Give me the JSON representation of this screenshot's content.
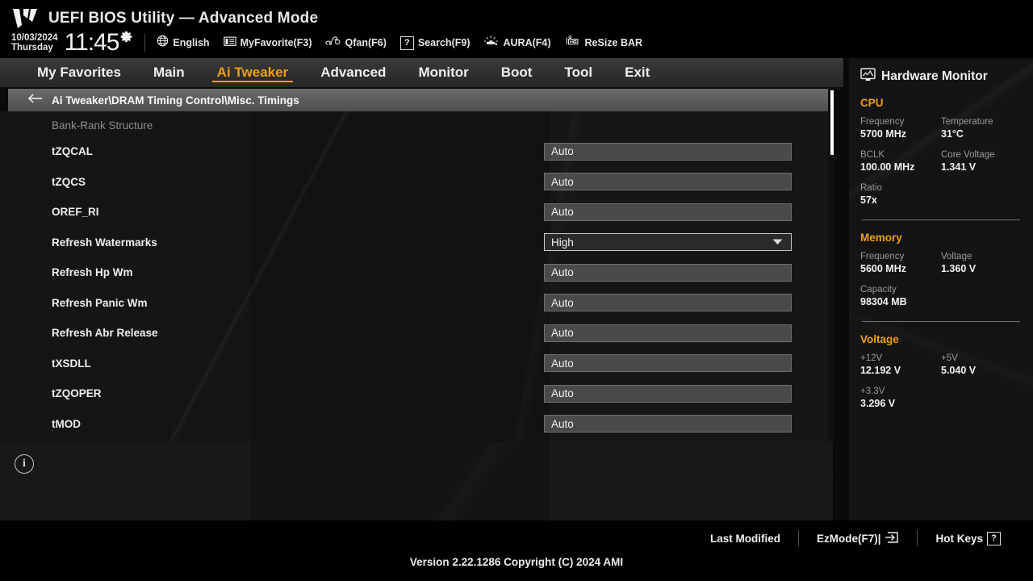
{
  "header": {
    "logo_icon": "tuf-gaming-logo",
    "title": "UEFI BIOS Utility — Advanced Mode",
    "date": "10/03/2024",
    "day": "Thursday",
    "time": "11:45",
    "gear_icon": "gear-icon",
    "items": [
      {
        "icon": "globe-icon",
        "label": "English"
      },
      {
        "icon": "favorites-icon",
        "label": "MyFavorite(F3)"
      },
      {
        "icon": "fan-icon",
        "label": "Qfan(F6)"
      },
      {
        "icon": "question-box-icon",
        "label": "Search(F9)"
      },
      {
        "icon": "aura-light-icon",
        "label": "AURA(F4)"
      },
      {
        "icon": "resize-bar-icon",
        "label": "ReSize BAR"
      }
    ]
  },
  "nav": {
    "tabs": [
      {
        "label": "My Favorites",
        "active": false
      },
      {
        "label": "Main",
        "active": false
      },
      {
        "label": "Ai Tweaker",
        "active": true
      },
      {
        "label": "Advanced",
        "active": false
      },
      {
        "label": "Monitor",
        "active": false
      },
      {
        "label": "Boot",
        "active": false
      },
      {
        "label": "Tool",
        "active": false
      },
      {
        "label": "Exit",
        "active": false
      }
    ]
  },
  "breadcrumb": {
    "back_icon": "back-arrow-icon",
    "path": "Ai Tweaker\\DRAM Timing Control\\Misc. Timings"
  },
  "main": {
    "group_header": "Bank-Rank Structure",
    "settings": [
      {
        "label": "tZQCAL",
        "value": "Auto",
        "focused": false
      },
      {
        "label": "tZQCS",
        "value": "Auto",
        "focused": false
      },
      {
        "label": "OREF_RI",
        "value": "Auto",
        "focused": false
      },
      {
        "label": "Refresh Watermarks",
        "value": "High",
        "focused": true
      },
      {
        "label": "Refresh Hp Wm",
        "value": "Auto",
        "focused": false
      },
      {
        "label": "Refresh Panic Wm",
        "value": "Auto",
        "focused": false
      },
      {
        "label": "Refresh Abr Release",
        "value": "Auto",
        "focused": false
      },
      {
        "label": "tXSDLL",
        "value": "Auto",
        "focused": false
      },
      {
        "label": "tZQOPER",
        "value": "Auto",
        "focused": false
      },
      {
        "label": "tMOD",
        "value": "Auto",
        "focused": false
      }
    ],
    "help_info_icon": "info-circle-icon"
  },
  "hardware_monitor": {
    "icon": "monitor-icon",
    "title": "Hardware Monitor",
    "sections": [
      {
        "title": "CPU",
        "entries": [
          {
            "key": "Frequency",
            "value": "5700 MHz",
            "full": false
          },
          {
            "key": "Temperature",
            "value": "31°C",
            "full": false
          },
          {
            "key": "BCLK",
            "value": "100.00 MHz",
            "full": false
          },
          {
            "key": "Core Voltage",
            "value": "1.341 V",
            "full": false
          },
          {
            "key": "Ratio",
            "value": "57x",
            "full": true
          }
        ]
      },
      {
        "title": "Memory",
        "entries": [
          {
            "key": "Frequency",
            "value": "5600 MHz",
            "full": false
          },
          {
            "key": "Voltage",
            "value": "1.360 V",
            "full": false
          },
          {
            "key": "Capacity",
            "value": "98304 MB",
            "full": true
          }
        ]
      },
      {
        "title": "Voltage",
        "entries": [
          {
            "key": "+12V",
            "value": "12.192 V",
            "full": false
          },
          {
            "key": "+5V",
            "value": "5.040 V",
            "full": false
          },
          {
            "key": "+3.3V",
            "value": "3.296 V",
            "full": true
          }
        ]
      }
    ]
  },
  "footer": {
    "links": [
      {
        "label": "Last Modified",
        "icon": ""
      },
      {
        "label": "EzMode(F7)|",
        "icon": "exit-arrow-icon"
      },
      {
        "label": "Hot Keys",
        "icon": "question-box-icon"
      }
    ],
    "version": "Version 2.22.1286 Copyright (C) 2024 AMI"
  },
  "colors": {
    "accent": "#eda011",
    "panel_bg": "#141212",
    "field_bg": "#4a4a4a",
    "text": "#f0f0f0"
  }
}
